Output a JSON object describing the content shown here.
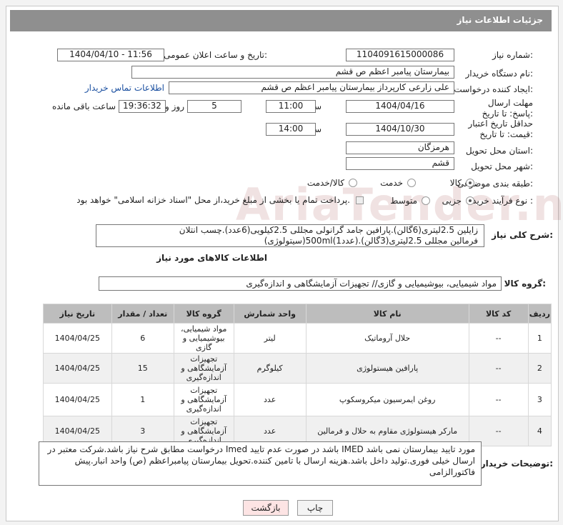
{
  "header": {
    "title": "جزئیات اطلاعات نیاز"
  },
  "form": {
    "need_number": {
      "label": "شماره نیاز:",
      "value": "1104091615000086"
    },
    "announce_date": {
      "label": "تاریخ و ساعت اعلان عمومی:",
      "value": "1404/04/10 - 11:56"
    },
    "buyer_org": {
      "label": "نام دستگاه خریدار:",
      "value": "بیمارستان پیامبر اعظم  ص  قشم"
    },
    "requester": {
      "label": "ایجاد کننده درخواست:",
      "value": "علی زارعی کارپرداز بیمارستان پیامبر اعظم  ص  قشم",
      "contact_link": "اطلاعات تماس خریدار"
    },
    "reply_deadline": {
      "label": "مهلت ارسال پاسخ: تا تاریخ:",
      "date": "1404/04/16",
      "time_label": "ساعت",
      "time": "11:00",
      "days": "5",
      "days_label": "روز و",
      "remaining": "19:36:32",
      "remaining_label": "ساعت باقی مانده"
    },
    "price_validity": {
      "label": "حداقل تاریخ اعتبار قیمت: تا تاریخ:",
      "date": "1404/10/30",
      "time_label": "ساعت",
      "time": "14:00"
    },
    "province": {
      "label": "استان محل تحویل:",
      "value": "هرمزگان"
    },
    "city": {
      "label": "شهر محل تحویل:",
      "value": "قشم"
    },
    "category": {
      "label": "طبقه بندی موضوعی:",
      "options": [
        "کالا",
        "خدمت",
        "کالا/خدمت"
      ],
      "selected": "کالا"
    },
    "process_type": {
      "label": "نوع فرآیند خرید :",
      "options": [
        "جزیی",
        "متوسط"
      ],
      "selected": "جزیی",
      "payment_note": "پرداخت تمام یا بخشی از مبلغ خرید،از محل \"اسناد خزانه اسلامی\" خواهد بود."
    }
  },
  "general_desc": {
    "label": "شرح کلی نیاز:",
    "line1": "زایلین 2.5لیتری(6گالن).پارافین جامد گرانولی مجللی 2.5کیلویی(6عدد).چسب انتلان",
    "line2": "(سیتولوژی)500ml(1عدد).فرمالین مجللی 2.5لیتری(3گالن)"
  },
  "goods_info": {
    "title": "اطلاعات کالاهای مورد نیاز",
    "group_label": "گروه کالا:",
    "group_value": "مواد شیمیایی، بیوشیمیایی و  گازی// تجهیزات آزمایشگاهی و اندازه‌گیری"
  },
  "table": {
    "headers": [
      "ردیف",
      "کد کالا",
      "نام کالا",
      "واحد شمارش",
      "گروه کالا",
      "تعداد / مقدار",
      "تاریخ نیاز"
    ],
    "rows": [
      {
        "row": "1",
        "code": "--",
        "name": "حلال آروماتیک",
        "unit": "لیتر",
        "group": "مواد شیمیایی، بیوشیمیایی و گازی",
        "qty": "6",
        "date": "1404/04/25"
      },
      {
        "row": "2",
        "code": "--",
        "name": "پارافین هیستولوژی",
        "unit": "کیلوگرم",
        "group": "تجهیزات آزمایشگاهی و اندازه‌گیری",
        "qty": "15",
        "date": "1404/04/25"
      },
      {
        "row": "3",
        "code": "--",
        "name": "روغن ایمرسیون میکروسکوپ",
        "unit": "عدد",
        "group": "تجهیزات آزمایشگاهی و اندازه‌گیری",
        "qty": "1",
        "date": "1404/04/25"
      },
      {
        "row": "4",
        "code": "--",
        "name": "مارکر هیستولوژی مقاوم به حلال و فرمالین",
        "unit": "عدد",
        "group": "تجهیزات آزمایشگاهی و اندازه‌گیری",
        "qty": "3",
        "date": "1404/04/25"
      }
    ]
  },
  "buyer_notes": {
    "label": "توضیحات خریدار:",
    "line1": "درخواست مطابق شرح نیاز باشد.شرکت معتبر در Imed  باشد در صورت عدم تایید IMED مورد تایید بیمارستان نمی باشد",
    "line2": "ارسال خیلی فوری.تولید داخل باشد.هزینه ارسال با تامین کننده.تحویل  بیمارستان پیامبراعظم (ص) واحد انبار.پیش",
    "line3": "فاکتورالزامی"
  },
  "buttons": {
    "print": "چاپ",
    "back": "بازگشت"
  },
  "watermark": "AriaTender.net"
}
